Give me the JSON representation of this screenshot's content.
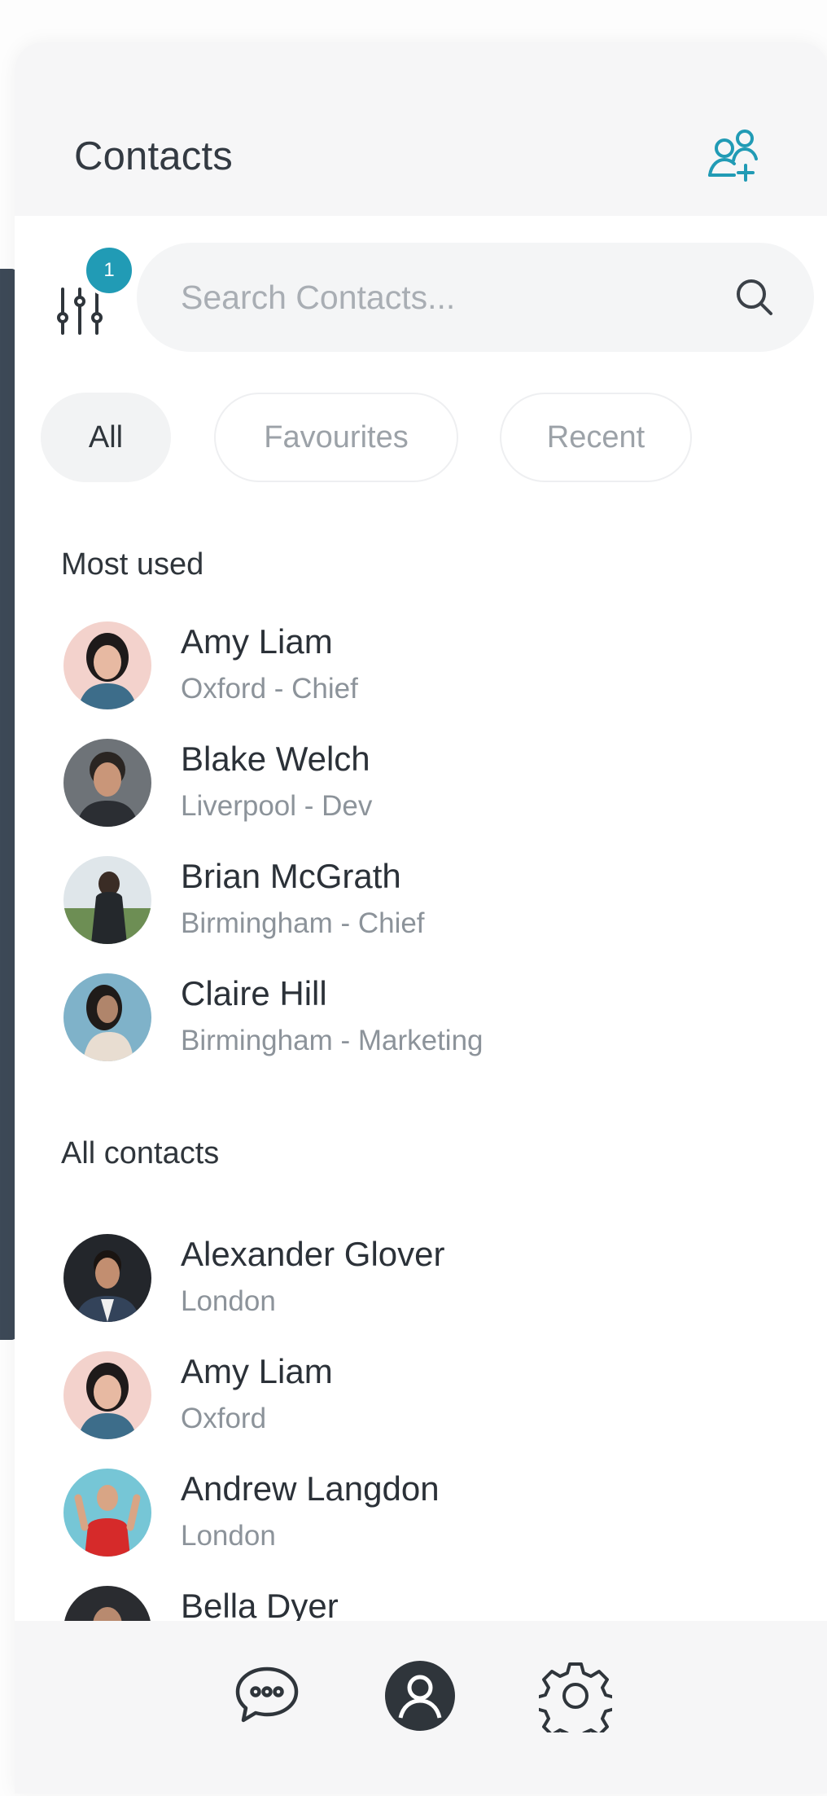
{
  "header": {
    "title": "Contacts"
  },
  "filter": {
    "badge_count": "1"
  },
  "search": {
    "placeholder": "Search Contacts..."
  },
  "tabs": [
    {
      "label": "All",
      "active": true
    },
    {
      "label": "Favourites",
      "active": false
    },
    {
      "label": "Recent",
      "active": false
    }
  ],
  "most_used": {
    "title": "Most used",
    "items": [
      {
        "name": "Amy Liam",
        "detail": "Oxford - Chief"
      },
      {
        "name": "Blake Welch",
        "detail": "Liverpool - Dev"
      },
      {
        "name": "Brian McGrath",
        "detail": "Birmingham - Chief"
      },
      {
        "name": "Claire Hill",
        "detail": "Birmingham - Marketing"
      }
    ]
  },
  "all_contacts": {
    "title": "All contacts",
    "items": [
      {
        "name": "Alexander Glover",
        "detail": "London"
      },
      {
        "name": "Amy Liam",
        "detail": "Oxford"
      },
      {
        "name": "Andrew Langdon",
        "detail": "London"
      },
      {
        "name": "Bella Dyer",
        "detail": ""
      }
    ]
  },
  "colors": {
    "accent": "#219bb5",
    "text_primary": "#2b3138",
    "text_secondary": "#8c939a",
    "header_bg": "#f6f6f7",
    "sidebar_strip": "#3d4957"
  },
  "icons": {
    "add_contact": "add-user-icon",
    "filter": "sliders-icon",
    "search": "search-icon",
    "nav_chat": "chat-bubble-icon",
    "nav_contacts": "user-icon",
    "nav_settings": "gear-icon"
  }
}
